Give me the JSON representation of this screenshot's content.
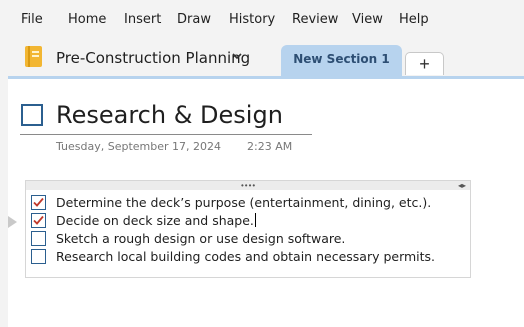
{
  "menu": [
    "File",
    "Home",
    "Insert",
    "Draw",
    "History",
    "Review",
    "View",
    "Help"
  ],
  "notebook": {
    "name": "Pre-Construction Planning",
    "icon": "notebook-icon",
    "color": "#f2b632"
  },
  "sections": {
    "active_tab": "New Section 1",
    "add_label": "+"
  },
  "page": {
    "title": "Research & Design",
    "date": "Tuesday, September 17, 2024",
    "time": "2:23 AM"
  },
  "note": {
    "items": [
      {
        "text": "Determine the deck’s purpose (entertainment, dining, etc.).",
        "checked": true
      },
      {
        "text": "Decide on deck size and shape.",
        "checked": true
      },
      {
        "text": "Sketch a rough design or use design software.",
        "checked": false
      },
      {
        "text": "Research local building codes and obtain necessary permits.",
        "checked": false
      }
    ]
  },
  "colors": {
    "accent": "#b7d3ee",
    "checkbox_border": "#2b5f8f",
    "checkmark": "#c0392b"
  }
}
